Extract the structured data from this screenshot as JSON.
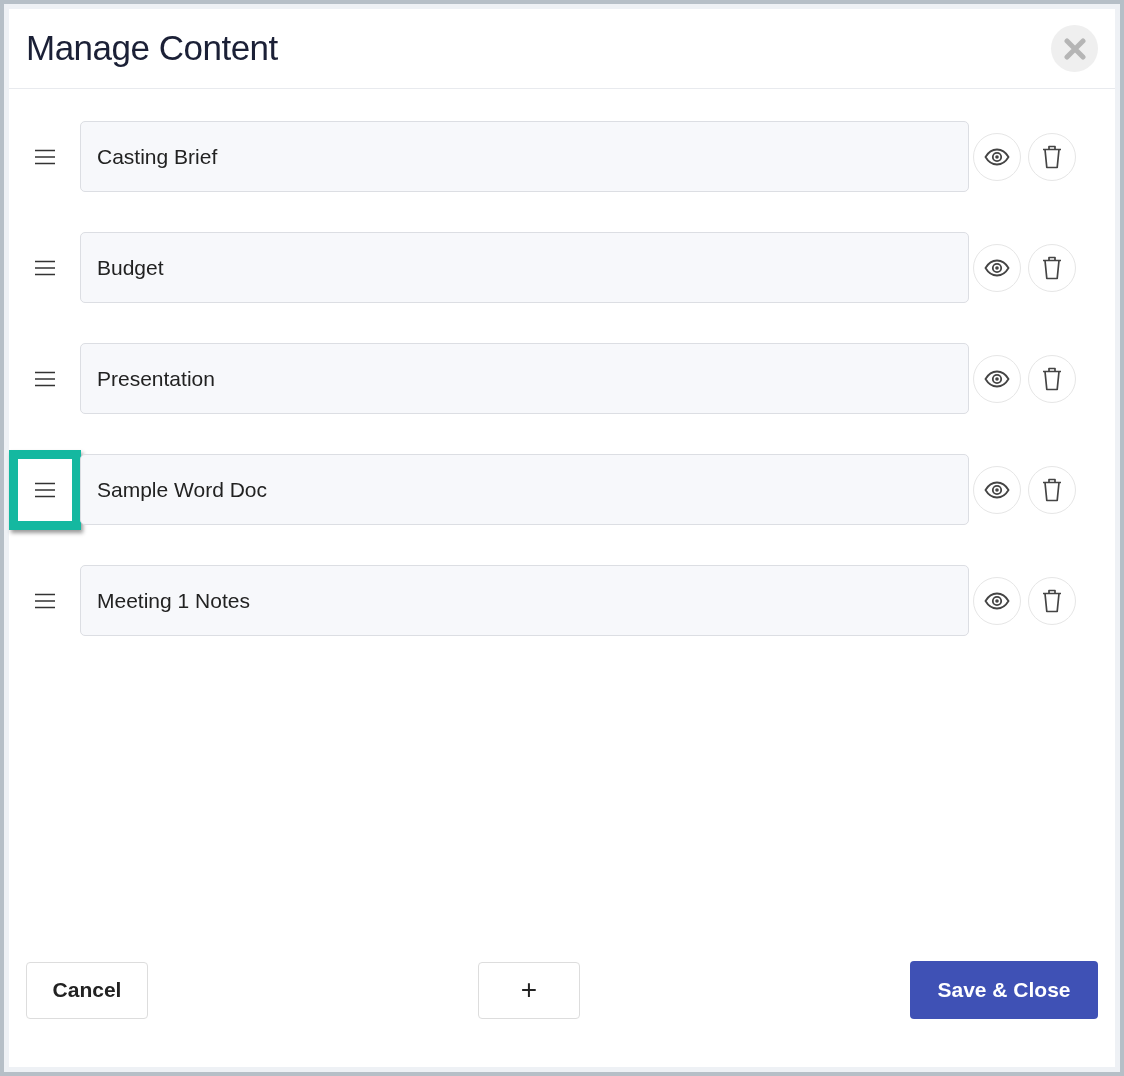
{
  "dialog": {
    "title": "Manage Content"
  },
  "items": [
    {
      "value": "Casting Brief",
      "highlighted": false
    },
    {
      "value": "Budget",
      "highlighted": false
    },
    {
      "value": "Presentation",
      "highlighted": false
    },
    {
      "value": "Sample Word Doc",
      "highlighted": true
    },
    {
      "value": "Meeting 1 Notes",
      "highlighted": false
    }
  ],
  "footer": {
    "cancel": "Cancel",
    "add": "+",
    "save": "Save & Close"
  }
}
